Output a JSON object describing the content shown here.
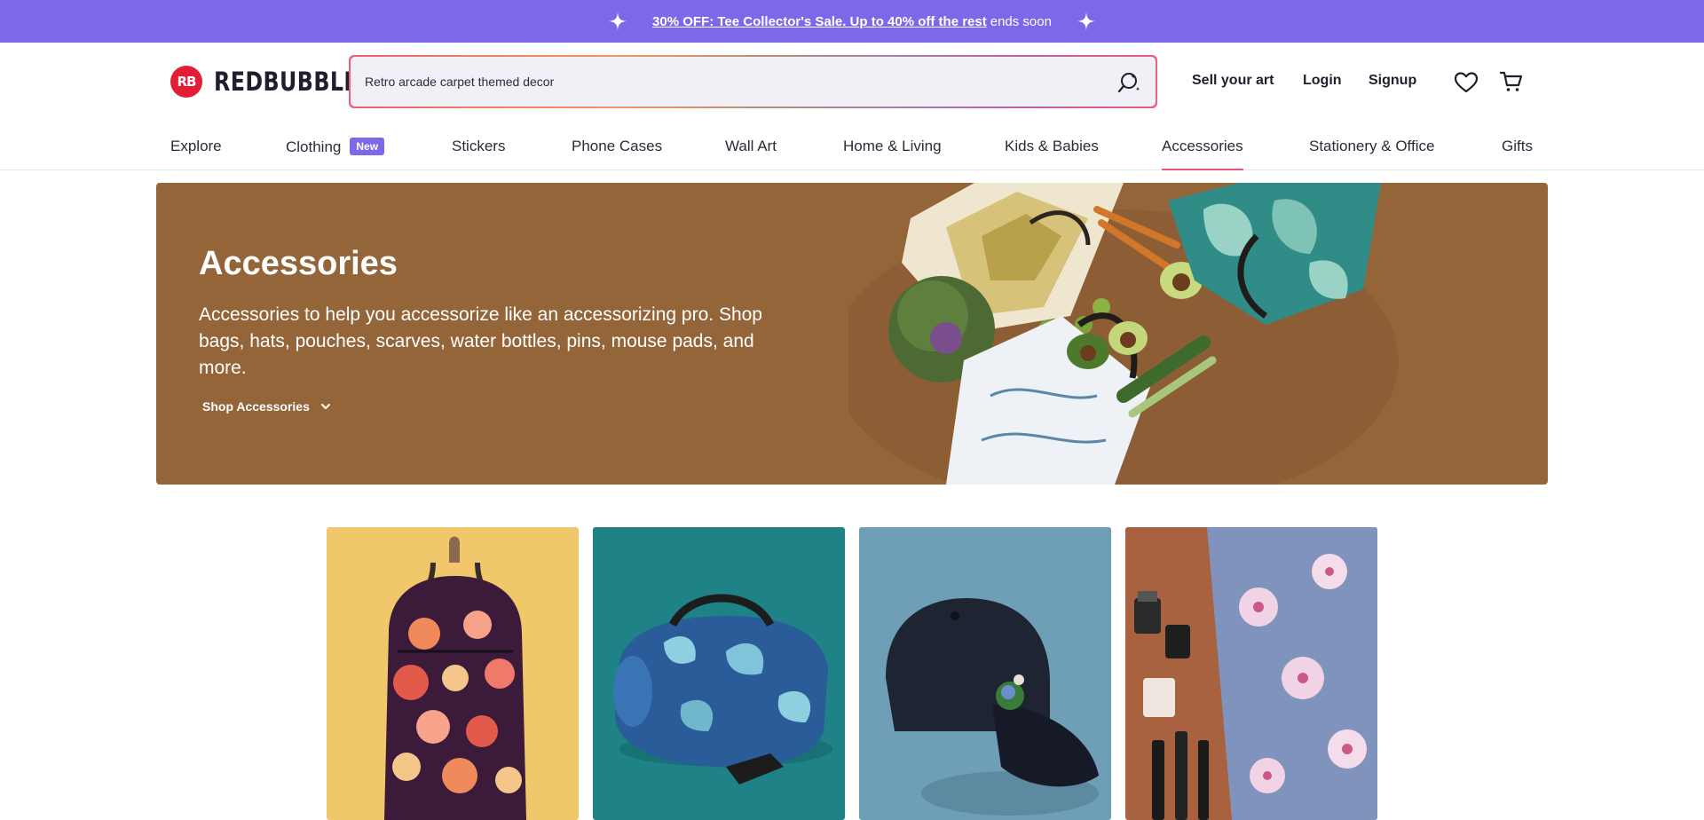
{
  "promo": {
    "link_text": "30% OFF: Tee Collector's Sale. Up to 40% off the rest",
    "tail_text": "ends soon",
    "bg_color": "#7c68e8",
    "icons": [
      "sparkle-icon",
      "sparkle-icon"
    ]
  },
  "header": {
    "logo_mark": "RB",
    "logo_text": "REDBUBBLE",
    "search": {
      "value": "Retro arcade carpet themed decor",
      "icon": "search-icon"
    },
    "sell_label": "Sell your art",
    "login_label": "Login",
    "signup_label": "Signup",
    "icons": [
      "heart-icon",
      "cart-icon"
    ],
    "brand_color": "#e41d36"
  },
  "nav": {
    "items": [
      {
        "label": "Explore"
      },
      {
        "label": "Clothing",
        "badge": "New"
      },
      {
        "label": "Stickers"
      },
      {
        "label": "Phone Cases"
      },
      {
        "label": "Wall Art"
      },
      {
        "label": "Home & Living"
      },
      {
        "label": "Kids & Babies"
      },
      {
        "label": "Accessories",
        "active": true
      },
      {
        "label": "Stationery & Office"
      },
      {
        "label": "Gifts"
      }
    ],
    "active_color": "#e55a7a"
  },
  "hero": {
    "title": "Accessories",
    "description": "Accessories to help you accessorize like an accessorizing pro. Shop bags, hats, pouches, scarves, water bottles, pins, mouse pads, and more.",
    "shop_label": "Shop Accessories",
    "bg_color": "#95653a"
  },
  "tiles": [
    {
      "name": "backpack",
      "bg_color": "#f0c76a"
    },
    {
      "name": "duffle-bag",
      "bg_color": "#1e8286"
    },
    {
      "name": "baseball-cap",
      "bg_color": "#6f9fb6"
    },
    {
      "name": "zipper-pouch",
      "bg_color": "#a8623f"
    }
  ]
}
